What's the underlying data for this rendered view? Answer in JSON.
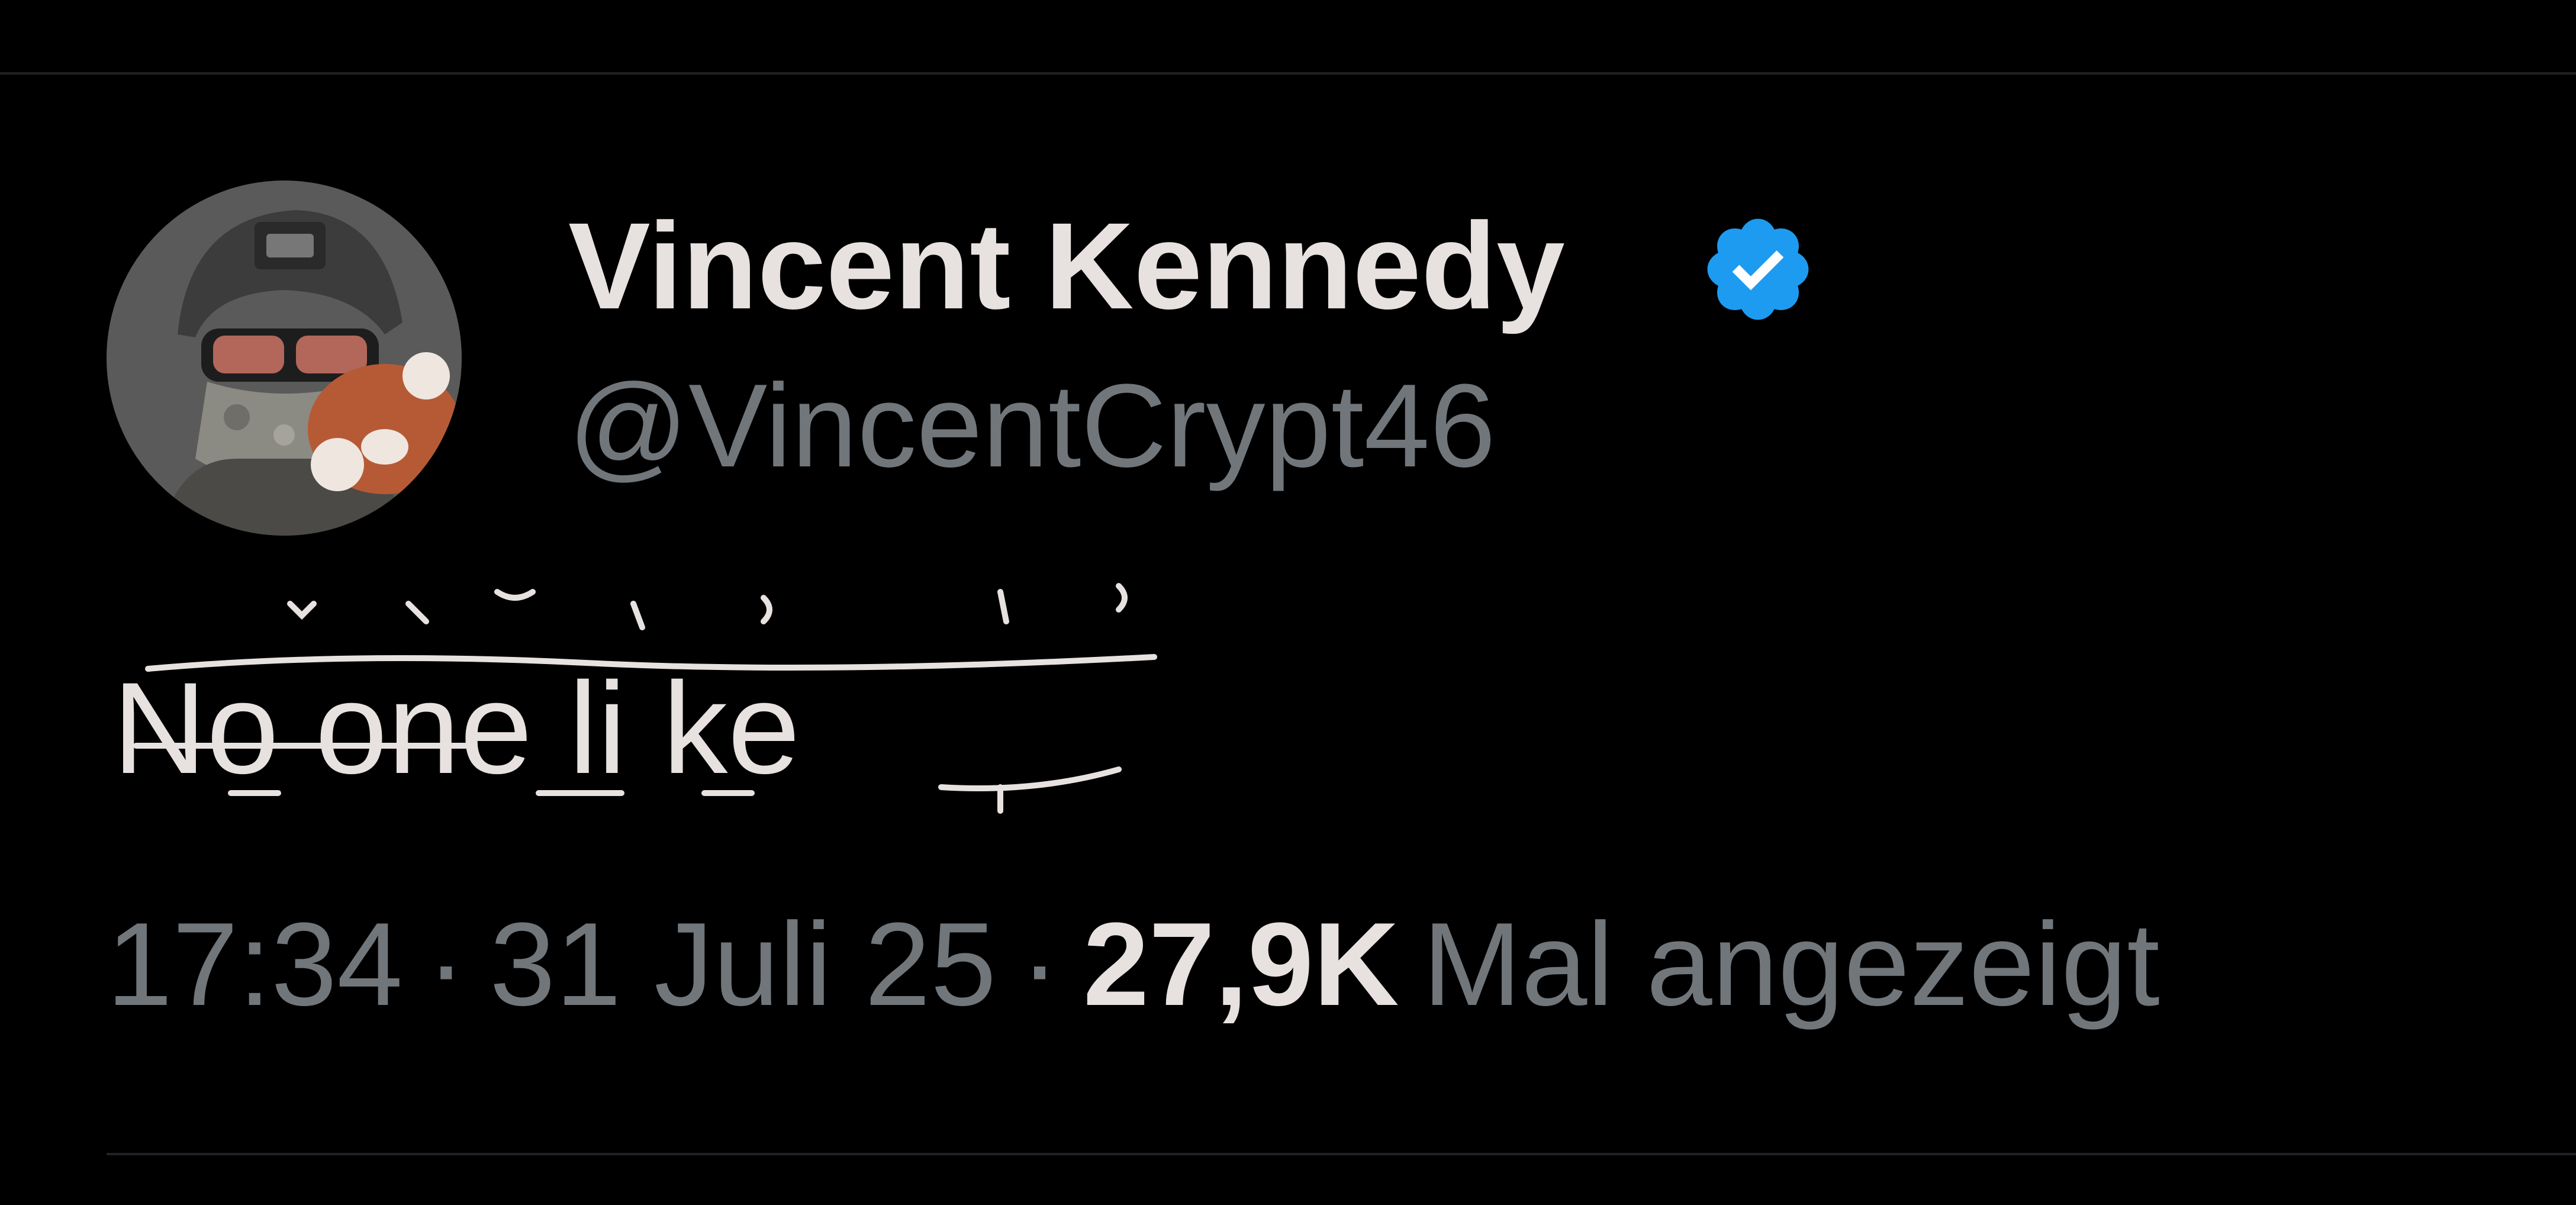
{
  "tweet": {
    "author": {
      "display_name": "Vincent Kennedy",
      "handle": "@VincentCrypt46",
      "verified": true,
      "verified_color": "#1d9bf0",
      "avatar_icon": "profile-photo"
    },
    "text": "No one li ke",
    "meta": {
      "time": "17:34",
      "separator": "·",
      "date": "31 Juli 25",
      "views_count": "27,9K",
      "views_label": "Mal angezeigt"
    }
  },
  "colors": {
    "background": "#000000",
    "primary_text": "#e7e2e0",
    "secondary_text": "#71767b",
    "divider": "#1f2226"
  }
}
